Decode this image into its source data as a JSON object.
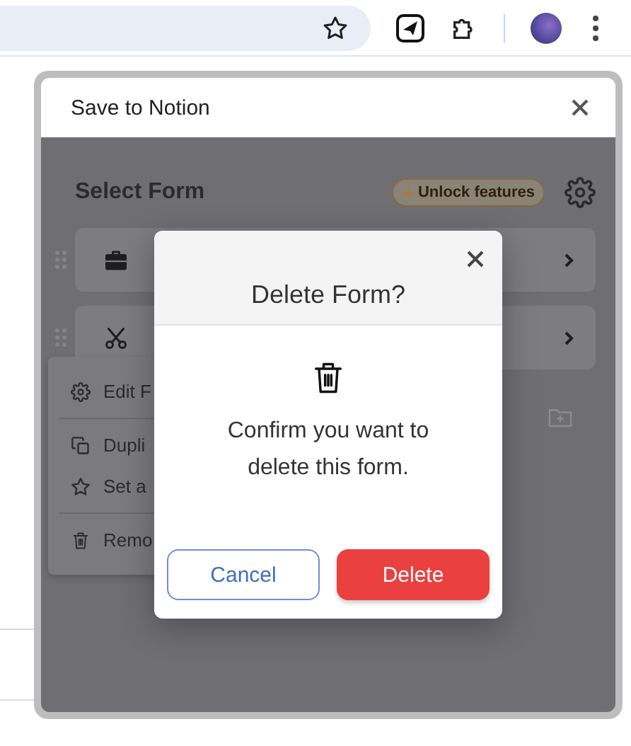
{
  "popup": {
    "title": "Save to Notion",
    "heading": "Select Form",
    "unlock_badge": "Unlock features",
    "forms": [
      {
        "kind": "briefcase"
      },
      {
        "kind": "scissors"
      }
    ],
    "context_menu": {
      "sections": [
        [
          {
            "label": "Edit F",
            "kind": "gear"
          }
        ],
        [
          {
            "label": "Dupli",
            "kind": "copy"
          },
          {
            "label": "Set a",
            "kind": "star"
          }
        ],
        [
          {
            "label": "Remo",
            "kind": "trash"
          }
        ]
      ]
    }
  },
  "dialog": {
    "title": "Delete Form?",
    "message": "Confirm you want to delete this form.",
    "buttons": [
      {
        "label": "Cancel",
        "kind": "secondary"
      },
      {
        "label": "Delete",
        "kind": "danger"
      }
    ]
  }
}
